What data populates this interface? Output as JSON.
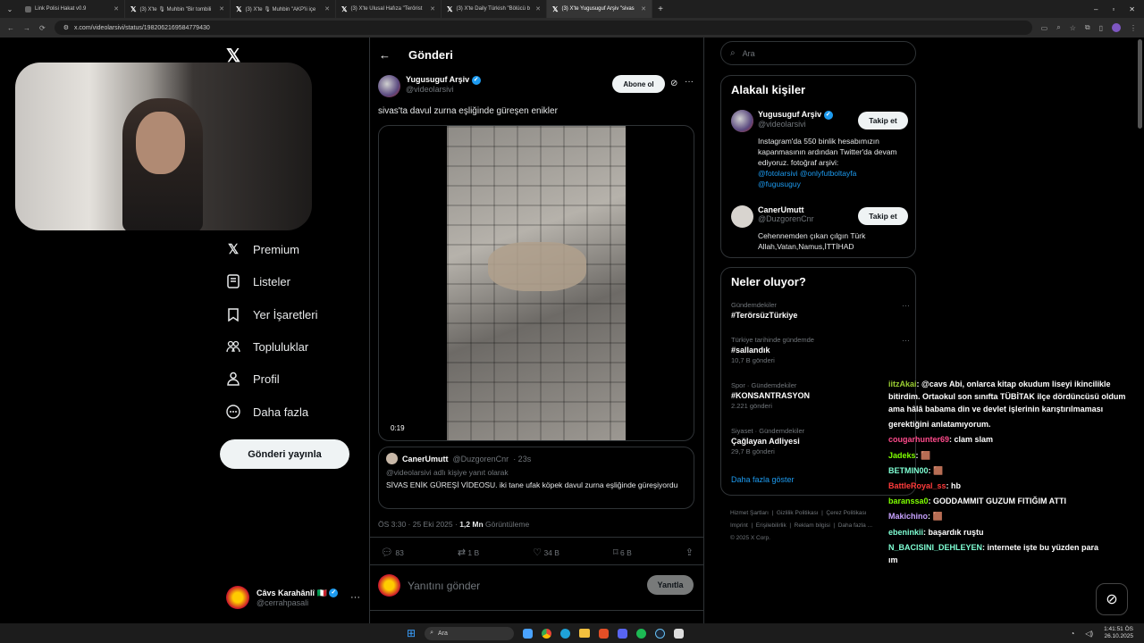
{
  "browser": {
    "tabs": [
      {
        "label": "Link Polisi Hakat v0.9"
      },
      {
        "label": "(3) X'te 🎙 Muhbin \"Bir tombili"
      },
      {
        "label": "(3) X'te 🎙 Muhbin \"AKP'li içe"
      },
      {
        "label": "(3) X'te Ulusal Hafıza \"Terörist"
      },
      {
        "label": "(3) X'te Daily Türkish \"Bölücü b"
      },
      {
        "label": "(3) X'te Yugusuguf Arşiv \"sivas"
      }
    ],
    "url": "x.com/videolarsivi/status/1982062169584779430",
    "new_tab": "+"
  },
  "nav": {
    "items": [
      {
        "label": "Premium"
      },
      {
        "label": "Listeler"
      },
      {
        "label": "Yer İşaretleri"
      },
      {
        "label": "Topluluklar"
      },
      {
        "label": "Profil"
      },
      {
        "label": "Daha fazla"
      }
    ],
    "post_button": "Gönderi yayınla",
    "account": {
      "name": "Câvs Karahânlî 🇮🇹",
      "handle": "@cerrahpasali"
    }
  },
  "post": {
    "header_title": "Gönderi",
    "author": "Yugusuguf Arşiv",
    "handle": "@videolarsivi",
    "subscribe": "Abone ol",
    "text": "sivas'ta davul zurna eşliğinde güreşen enikler",
    "video_time": "0:19",
    "quoted": {
      "author": "CanerUmutt",
      "handle": "@DuzgorenCnr",
      "time": "· 23s",
      "reply_to": "@videolarsivi adlı kişiye yanıt olarak",
      "text": "SİVAS ENİK GÜREŞİ VİDEOSU. iki tane ufak köpek davul zurna eşliğinde güreşiyordu"
    },
    "timestamp": "ÖS 3:30 · 25 Eki 2025 ·",
    "views_count": "1,2 Mn",
    "views_label": "Görüntüleme",
    "stats": {
      "replies": "83",
      "reposts": "1 B",
      "likes": "34 B",
      "bookmarks": "6 B"
    },
    "reply_placeholder": "Yanıtını gönder",
    "reply_button": "Yanıtla"
  },
  "search": {
    "placeholder": "Ara"
  },
  "related": {
    "title": "Alakalı kişiler",
    "people": [
      {
        "name": "Yugusuguf Arşiv",
        "handle": "@videolarsivi",
        "button": "Takip et",
        "bio": "Instagram'da 550 binlik hesabımızın kapanmasının ardından Twitter'da devam ediyoruz. fotoğraf arşivi:",
        "links": "@fotolarsivi @onlyfutboltayfa @fugusuguy"
      },
      {
        "name": "CanerUmutt",
        "handle": "@DuzgorenCnr",
        "button": "Takip et",
        "bio": "Cehennemden çıkan çılgın Türk Allah,Vatan,Namus,İTTİHAD"
      }
    ]
  },
  "trends": {
    "title": "Neler oluyor?",
    "items": [
      {
        "context": "Gündemdekiler",
        "name": "#TerörsüzTürkiye",
        "count": ""
      },
      {
        "context": "Türkiye tarihinde gündemde",
        "name": "#sallandık",
        "count": "10,7 B gönderi"
      },
      {
        "context": "Spor · Gündemdekiler",
        "name": "#KONSANTRASYON",
        "count": "2.221 gönderi"
      },
      {
        "context": "Siyaset · Gündemdekiler",
        "name": "Çağlayan Adliyesi",
        "count": "29,7 B gönderi"
      }
    ],
    "more": "Daha fazla göster"
  },
  "footer": {
    "links": [
      "Hizmet Şartları",
      "Gizlilik Politikası",
      "Çerez Politikası",
      "Imprint",
      "Erişilebilirlik",
      "Reklam bilgisi",
      "Daha fazla ..."
    ],
    "copyright": "© 2025 X Corp."
  },
  "chat": [
    {
      "user": "iitzAkai",
      "color": "#9acd32",
      "msg": ": @cavs Abi, onlarca kitap okudum liseyi ikincilikle"
    },
    {
      "user": "",
      "color": "#fff",
      "msg": "bitirdim. Ortaokul son sınıfta TÜBİTAK ilçe dördüncüsü oldum"
    },
    {
      "user": "",
      "color": "#fff",
      "msg": "ama hâlâ babama din ve devlet işlerinin karıştırılmaması"
    },
    {
      "user": "",
      "color": "#fff",
      "msg": "gerektiğini anlatamıyorum."
    },
    {
      "user": "cougarhunter69",
      "color": "#ff4a8b",
      "msg": ": clam slam"
    },
    {
      "user": "Jadeks",
      "color": "#7fff00",
      "msg": ": 🟫"
    },
    {
      "user": "BETMIN00",
      "color": "#7fffd4",
      "msg": ": 🟫"
    },
    {
      "user": "BattleRoyal_ss",
      "color": "#ff3b3b",
      "msg": ": hb"
    },
    {
      "user": "baranssa0",
      "color": "#7fff00",
      "msg": ": GODDAMMIT GUZUM FITIĞIM ATTI"
    },
    {
      "user": "Makichino",
      "color": "#c8a2ff",
      "msg": ": 🟫"
    },
    {
      "user": "ebeninkii",
      "color": "#7fffd4",
      "msg": ": başardık ruştu"
    },
    {
      "user": "N_BACISINI_DEHLEYEN",
      "color": "#7fffd4",
      "msg": ": internete işte bu yüzden para"
    },
    {
      "user": "",
      "color": "#fff",
      "msg": "ım"
    }
  ],
  "taskbar": {
    "search": "Ara",
    "time": "1:41:51 ÖS",
    "date": "26.10.2025"
  }
}
